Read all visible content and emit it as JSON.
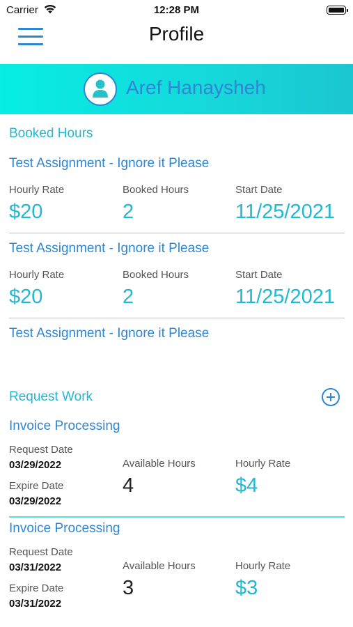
{
  "status_bar": {
    "carrier": "Carrier",
    "time": "12:28 PM"
  },
  "nav": {
    "title": "Profile",
    "menu_icon": "hamburger-menu-icon"
  },
  "profile": {
    "name": "Aref Hanaysheh",
    "avatar_icon": "user-avatar-icon"
  },
  "booked_hours": {
    "section_label": "Booked Hours",
    "labels": {
      "hourly_rate": "Hourly Rate",
      "booked_hours": "Booked Hours",
      "start_date": "Start Date"
    },
    "items": [
      {
        "title": "Test Assignment - Ignore it Please",
        "hourly_rate": "$20",
        "booked_hours": "2",
        "start_date": "11/25/2021"
      },
      {
        "title": "Test Assignment - Ignore it Please",
        "hourly_rate": "$20",
        "booked_hours": "2",
        "start_date": "11/25/2021"
      },
      {
        "title": "Test Assignment - Ignore it Please"
      }
    ]
  },
  "request_work": {
    "section_label": "Request Work",
    "add_icon": "plus-circle-icon",
    "labels": {
      "request_date": "Request Date",
      "expire_date": "Expire Date",
      "available_hours": "Available Hours",
      "hourly_rate": "Hourly Rate"
    },
    "items": [
      {
        "title": "Invoice Processing",
        "request_date": "03/29/2022",
        "expire_date": "03/29/2022",
        "available_hours": "4",
        "hourly_rate": "$4"
      },
      {
        "title": "Invoice Processing",
        "request_date": "03/31/2022",
        "expire_date": "03/31/2022",
        "available_hours": "3",
        "hourly_rate": "$3"
      }
    ]
  },
  "colors": {
    "accent_teal": "#22b8cf",
    "accent_blue": "#2f86d3",
    "banner_start": "#06ede3",
    "banner_end": "#1bc6d2"
  }
}
